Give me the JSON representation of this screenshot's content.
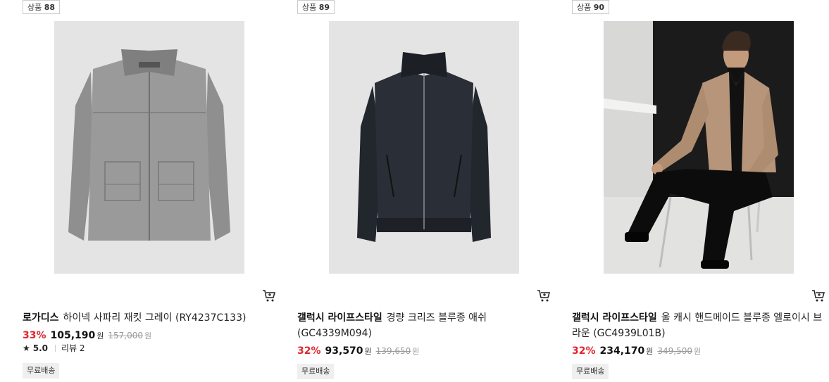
{
  "products": [
    {
      "rank_prefix": "상품",
      "rank": "88",
      "brand": "로가디스",
      "name": "하이넥 사파리 재킷 그레이 (RY4237C133)",
      "discount": "33%",
      "price": "105,190",
      "price_unit": "원",
      "original_price": "157,000",
      "original_unit": "원",
      "rating": "5.0",
      "review_label": "리뷰 2",
      "shipping": "무료배송",
      "image_icon": "gray-safari-jacket-image"
    },
    {
      "rank_prefix": "상품",
      "rank": "89",
      "brand": "갤럭시 라이프스타일",
      "name": "경량 크리즈 블루종 애쉬 (GC4339M094)",
      "discount": "32%",
      "price": "93,570",
      "price_unit": "원",
      "original_price": "139,650",
      "original_unit": "원",
      "shipping": "무료배송",
      "image_icon": "black-blouson-jacket-image"
    },
    {
      "rank_prefix": "상품",
      "rank": "90",
      "brand": "갤럭시 라이프스타일",
      "name": "울 캐시 핸드메이드 블루종 엘로이시 브라운 (GC4939L01B)",
      "discount": "32%",
      "price": "234,170",
      "price_unit": "원",
      "original_price": "349,500",
      "original_unit": "원",
      "shipping": "무료배송",
      "image_icon": "model-wearing-brown-blouson-photo"
    }
  ],
  "colors": {
    "discount": "#e0262d",
    "badge_bg": "#efefef",
    "image_bg": "#e4e4e4"
  }
}
